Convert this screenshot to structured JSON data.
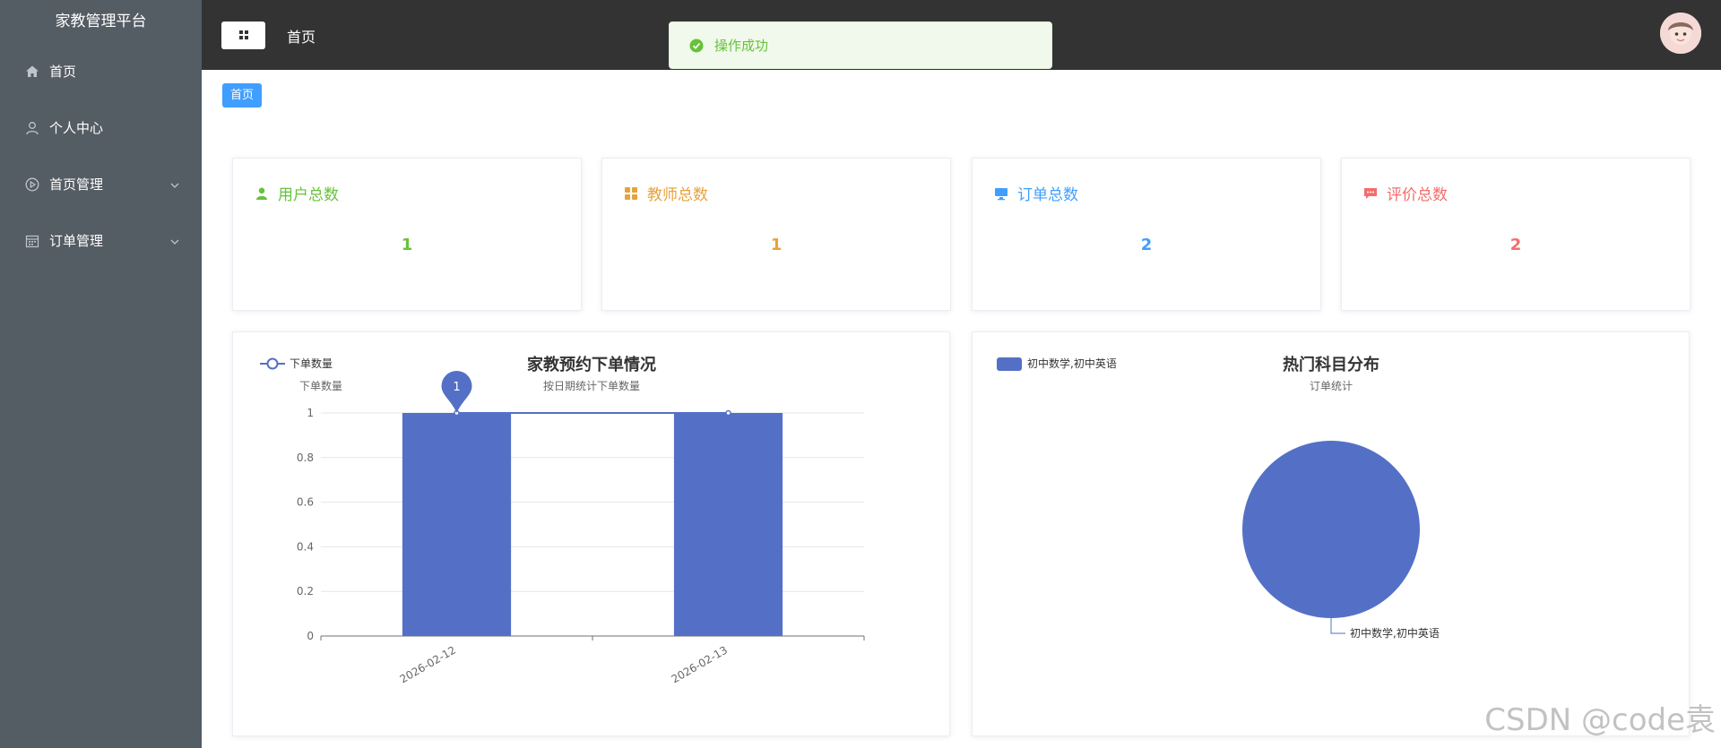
{
  "app": {
    "title": "家教管理平台"
  },
  "sidebar": {
    "items": [
      {
        "label": "首页",
        "icon": "home-icon",
        "has_submenu": false
      },
      {
        "label": "个人中心",
        "icon": "user-icon",
        "has_submenu": false
      },
      {
        "label": "首页管理",
        "icon": "play-circle-icon",
        "has_submenu": true
      },
      {
        "label": "订单管理",
        "icon": "calendar-icon",
        "has_submenu": true
      }
    ]
  },
  "header": {
    "title": "首页"
  },
  "toast": {
    "message": "操作成功",
    "type": "success"
  },
  "breadcrumb": {
    "label": "首页"
  },
  "stats": [
    {
      "label": "用户总数",
      "value": "1",
      "color": "#67c23a",
      "icon": "user-solid-icon"
    },
    {
      "label": "教师总数",
      "value": "1",
      "color": "#e6a23c",
      "icon": "grid-icon"
    },
    {
      "label": "订单总数",
      "value": "2",
      "color": "#409eff",
      "icon": "monitor-icon"
    },
    {
      "label": "评价总数",
      "value": "2",
      "color": "#f56c6c",
      "icon": "comment-icon"
    }
  ],
  "chart_data": [
    {
      "type": "bar",
      "title": "家教预约下单情况",
      "subtitle": "按日期统计下单数量",
      "ylabel": "下单数量",
      "xlabel": "",
      "legend": [
        "下单数量"
      ],
      "legend_position": "top-left",
      "categories": [
        "2026-02-12",
        "2026-02-13"
      ],
      "series": [
        {
          "name": "下单数量",
          "type": "bar",
          "values": [
            1,
            1
          ]
        },
        {
          "name": "下单数量",
          "type": "line",
          "values": [
            1,
            1
          ]
        }
      ],
      "y_ticks": [
        "0",
        "0.2",
        "0.4",
        "0.6",
        "0.8",
        "1"
      ],
      "ylim": [
        0,
        1
      ],
      "markpoint": {
        "category": "2026-02-12",
        "value": 1,
        "label": "1"
      },
      "color": "#5470c6",
      "grid": true
    },
    {
      "type": "pie",
      "title": "热门科目分布",
      "subtitle": "订单统计",
      "legend": [
        "初中数学,初中英语"
      ],
      "legend_position": "top-left",
      "slices": [
        {
          "label": "初中数学,初中英语",
          "value": 2
        }
      ],
      "color": "#5470c6"
    }
  ],
  "watermark": "CSDN @code袁"
}
